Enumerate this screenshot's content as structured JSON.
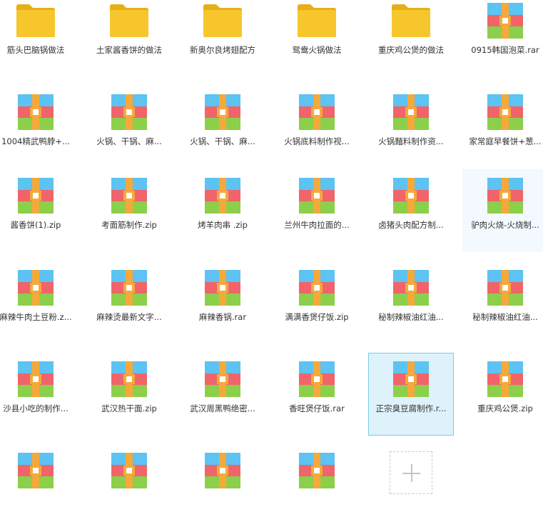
{
  "colors": {
    "folder_body": "#f7c62c",
    "folder_tab": "#e8ae16",
    "zip_top": "#5cc3f2",
    "zip_middle": "#f0646a",
    "zip_bottom": "#8ccf4b",
    "zip_strap": "#f5a93a",
    "zip_buckle": "#ffffff",
    "selected_bg": "#ddf2fb",
    "selected_border": "#7dcbea",
    "hover_bg": "#f3f9fe"
  },
  "items": [
    {
      "type": "folder",
      "label": "筋头巴脑锅做法"
    },
    {
      "type": "folder",
      "label": "土家酱香饼的做法"
    },
    {
      "type": "folder",
      "label": "新奥尔良烤翅配方"
    },
    {
      "type": "folder",
      "label": "鸳鸯火锅做法"
    },
    {
      "type": "folder",
      "label": "重庆鸡公煲的做法"
    },
    {
      "type": "archive",
      "label": "0915韩国泡菜.rar"
    },
    {
      "type": "archive",
      "label": "1004精武鸭脖+..."
    },
    {
      "type": "archive",
      "label": "火锅、干锅、麻..."
    },
    {
      "type": "archive",
      "label": "火锅、干锅、麻..."
    },
    {
      "type": "archive",
      "label": "火锅底料制作视..."
    },
    {
      "type": "archive",
      "label": "火锅麵料制作资..."
    },
    {
      "type": "archive",
      "label": "家常庭早餐饼+葱..."
    },
    {
      "type": "archive",
      "label": "酱香饼(1).zip"
    },
    {
      "type": "archive",
      "label": "考面筋制作.zip"
    },
    {
      "type": "archive",
      "label": "烤羊肉串 .zip"
    },
    {
      "type": "archive",
      "label": "兰州牛肉拉面的..."
    },
    {
      "type": "archive",
      "label": "卤猪头肉配方制..."
    },
    {
      "type": "archive",
      "label": "驴肉火烧-火烧制...",
      "state": "hover"
    },
    {
      "type": "archive",
      "label": "麻辣牛肉土豆粉.z..."
    },
    {
      "type": "archive",
      "label": "麻辣烫最新文字..."
    },
    {
      "type": "archive",
      "label": "麻辣香锅.rar"
    },
    {
      "type": "archive",
      "label": "满满香煲仔饭.zip"
    },
    {
      "type": "archive",
      "label": "秘制辣椒油红油..."
    },
    {
      "type": "archive",
      "label": "秘制辣椒油红油..."
    },
    {
      "type": "archive",
      "label": "沙县小吃的制作..."
    },
    {
      "type": "archive",
      "label": "武汉热干面.zip"
    },
    {
      "type": "archive",
      "label": "武汉周黑鸭绝密..."
    },
    {
      "type": "archive",
      "label": "香旺煲仔饭.rar"
    },
    {
      "type": "archive",
      "label": "正宗臭豆腐制作.r...",
      "state": "selected"
    },
    {
      "type": "archive",
      "label": "重庆鸡公煲.zip"
    },
    {
      "type": "archive",
      "label": ""
    },
    {
      "type": "archive",
      "label": ""
    },
    {
      "type": "archive",
      "label": ""
    },
    {
      "type": "archive",
      "label": ""
    },
    {
      "type": "add",
      "label": ""
    }
  ]
}
